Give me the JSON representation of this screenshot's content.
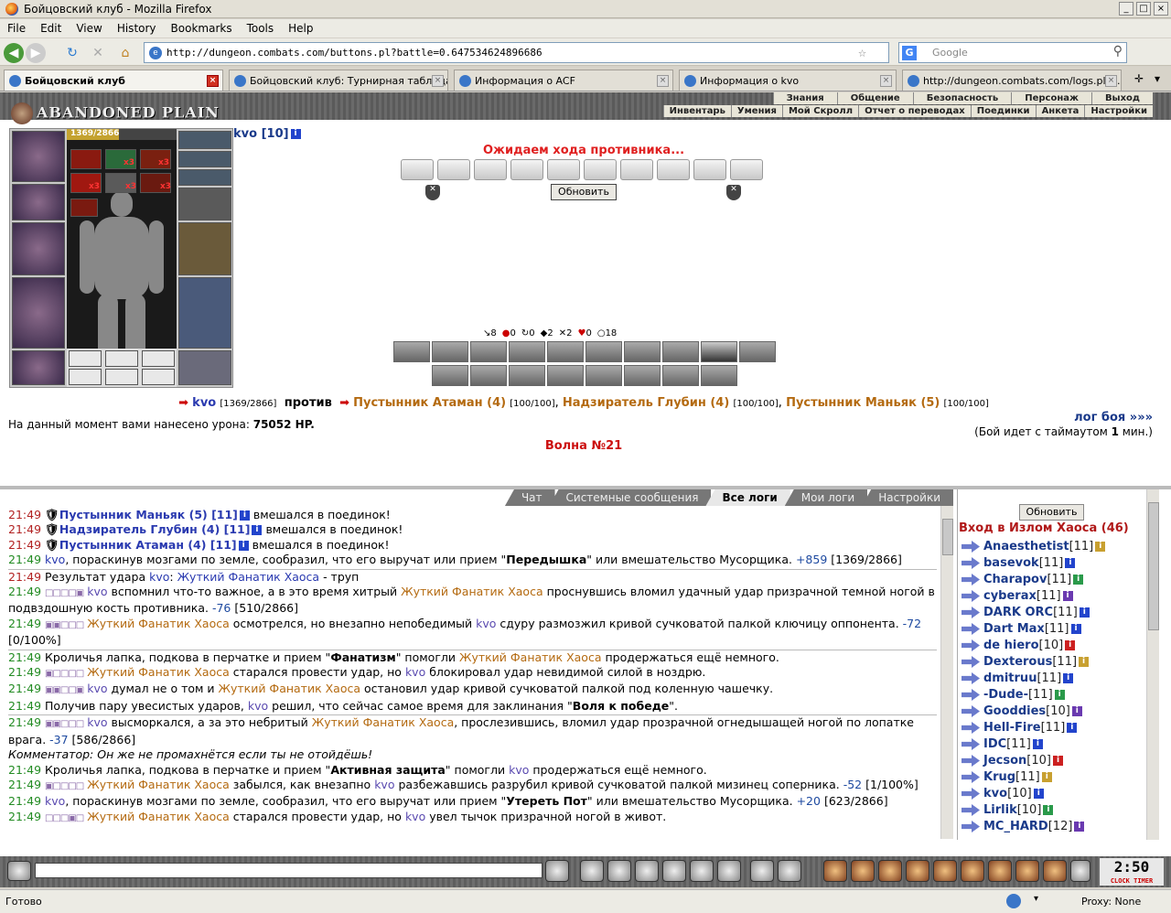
{
  "window": {
    "title": "Бойцовский клуб - Mozilla Firefox"
  },
  "menu": [
    "File",
    "Edit",
    "View",
    "History",
    "Bookmarks",
    "Tools",
    "Help"
  ],
  "nav": {
    "url": "http://dungeon.combats.com/buttons.pl?battle=0.647534624896686",
    "search_placeholder": "Google"
  },
  "tabs": [
    {
      "label": "Бойцовский клуб",
      "active": true
    },
    {
      "label": "Бойцовский клуб: Турнирная таблица",
      "active": false
    },
    {
      "label": "Информация о ACF",
      "active": false
    },
    {
      "label": "Информация о kvo",
      "active": false
    },
    {
      "label": "http://dungeon.combats.com/logs.pl?l...",
      "active": false
    }
  ],
  "game": {
    "logo": "ABANDONED PLAIN",
    "top_menu": [
      "Знания",
      "Общение",
      "Безопасность",
      "Персонаж",
      "Выход"
    ],
    "sub_menu": [
      "Инвентарь",
      "Умения",
      "Мой Скролл",
      "Отчет о переводах",
      "Поединки",
      "Анкета",
      "Настройки"
    ],
    "player": {
      "hp_text": "1369/2866",
      "hp_fraction": 0.478,
      "x3": "x3"
    },
    "opponent": {
      "name": "kvo",
      "level": "[10]"
    },
    "wait_title": "Ожидаем хода противника...",
    "refresh": "Обновить",
    "stats": [
      "8",
      "0",
      "0",
      "2",
      "2",
      "0",
      "18"
    ],
    "versus": {
      "me": "kvo",
      "me_hp": "[1369/2866]",
      "vs": "против",
      "enemies": [
        {
          "name": "Пустынник Атаман (4)",
          "hp": "[100/100]"
        },
        {
          "name": "Надзиратель Глубин (4)",
          "hp": "[100/100]"
        },
        {
          "name": "Пустынник Маньяк (5)",
          "hp": "[100/100]"
        }
      ]
    },
    "damage_label": "На данный момент вами нанесено урона:",
    "damage_value": "75052 HP.",
    "log_link": "лог боя »»»",
    "timeout_pre": "(Бой идет с таймаутом",
    "timeout_num": "1",
    "timeout_post": "мин.)",
    "wave": "Волна №21"
  },
  "chat": {
    "tabs": [
      "Чат",
      "Системные сообщения",
      "Все логи",
      "Мои логи",
      "Настройки"
    ],
    "active_tab": "Все логи"
  },
  "online": {
    "refresh": "Обновить",
    "room": "Вход в Излом Хаоса (46)",
    "users": [
      {
        "name": "Anaesthetist",
        "level": "[11]"
      },
      {
        "name": "basevok",
        "level": "[11]"
      },
      {
        "name": "Charapov",
        "level": "[11]"
      },
      {
        "name": "cyberax",
        "level": "[11]"
      },
      {
        "name": "DARK ORC",
        "level": "[11]"
      },
      {
        "name": "Dart Max",
        "level": "[11]"
      },
      {
        "name": "de hiero",
        "level": "[10]"
      },
      {
        "name": "Dexterous",
        "level": "[11]"
      },
      {
        "name": "dmitruu",
        "level": "[11]"
      },
      {
        "name": "-Dude-",
        "level": "[11]"
      },
      {
        "name": "Gooddies",
        "level": "[10]"
      },
      {
        "name": "Hell-Fire",
        "level": "[11]"
      },
      {
        "name": "IDC",
        "level": "[11]"
      },
      {
        "name": "Jecson",
        "level": "[10]"
      },
      {
        "name": "Krug",
        "level": "[11]"
      },
      {
        "name": "kvo",
        "level": "[10]"
      },
      {
        "name": "Lirlik",
        "level": "[10]"
      },
      {
        "name": "MC_HARD",
        "level": "[12]"
      }
    ]
  },
  "clock": {
    "time": "2:50",
    "sub": "CLOCK TIMER"
  },
  "status": {
    "left": "Готово",
    "proxy": "Proxy: None"
  }
}
